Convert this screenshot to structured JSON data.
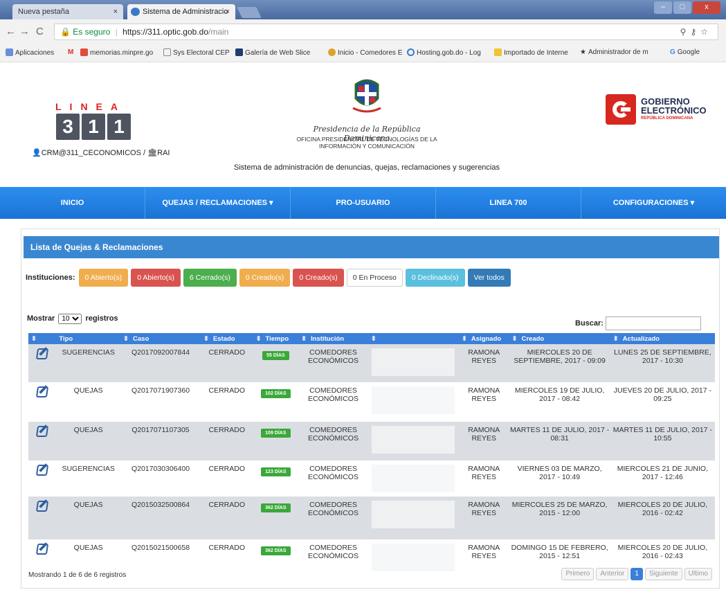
{
  "browser": {
    "tabs": [
      {
        "label": "Nueva pestaña"
      },
      {
        "label": "Sistema de Administracio"
      }
    ],
    "close_glyph": "×",
    "window_buttons": [
      "–",
      "□",
      "x"
    ],
    "secure_label": "Es seguro",
    "url_host": "https://311.optic.gob.do",
    "url_path": "/main",
    "bookmarks": [
      "Aplicaciones",
      "M",
      "memorias.minpre.go",
      "Sys Electoral CEP",
      "Galería de Web Slice",
      "Inicio - Comedores E",
      "Hosting.gob.do - Log",
      "Importado de Interne",
      "Administrador de m",
      "Google"
    ]
  },
  "header": {
    "linea_letters": "LINEA",
    "linea_digits": [
      "3",
      "1",
      "1"
    ],
    "user": "CRM@311_CECONOMICOS / ",
    "user_role": "RAI",
    "presidency": "Presidencia de la República Dominicana",
    "office": "OFICINA PRESIDENCIAL DE TECNOLOGÍAS DE LA INFORMACIÓN Y COMUNICACIÓN",
    "system_name": "Sistema de administración de denuncias, quejas, reclamaciones y sugerencias",
    "gob_line1": "GOBIERNO",
    "gob_line2": "ELECTRÓNICO",
    "gob_sub": "REPÚBLICA DOMINICANA"
  },
  "nav": {
    "items": [
      "INICIO",
      "QUEJAS / RECLAMACIONES ▾",
      "PRO-USUARIO",
      "LINEA 700",
      "CONFIGURACIONES ▾"
    ]
  },
  "panel": {
    "title": "Lista de Quejas & Reclamaciones",
    "instituciones_label": "Instituciones:",
    "filters": [
      {
        "label": "0 Abierto(s)",
        "color": "#f0ad4e"
      },
      {
        "label": "0 Abierto(s)",
        "color": "#d9534f"
      },
      {
        "label": "6 Cerrado(s)",
        "color": "#4cae4c"
      },
      {
        "label": "0 Creado(s)",
        "color": "#f0ad4e"
      },
      {
        "label": "0 Creado(s)",
        "color": "#d9534f"
      },
      {
        "label": "0 En Proceso",
        "color": "#ffffff"
      },
      {
        "label": "0 Declinado(s)",
        "color": "#5bc0de"
      },
      {
        "label": "Ver todos",
        "color": "#337ab7"
      }
    ],
    "show_label": "Mostrar",
    "show_value": "10",
    "records_label": "registros",
    "search_label": "Buscar:",
    "columns": [
      "",
      "Tipo",
      "Caso",
      "Estado",
      "Tiempo",
      "Institución",
      "",
      "Asignado",
      "Creado",
      "Actualizado"
    ],
    "rows": [
      {
        "tipo": "SUGERENCIAS",
        "caso": "Q2017092007844",
        "estado": "CERRADO",
        "tiempo": "55 DÍAS",
        "institucion": "COMEDORES ECONÓMICOS",
        "asignado": "RAMONA REYES",
        "creado": "MIERCOLES 20 DE SEPTIEMBRE, 2017 - 09:09",
        "actualizado": "LUNES 25 DE SEPTIEMBRE, 2017 - 10:30"
      },
      {
        "tipo": "QUEJAS",
        "caso": "Q2017071907360",
        "estado": "CERRADO",
        "tiempo": "102 DÍAS",
        "institucion": "COMEDORES ECONÓMICOS",
        "asignado": "RAMONA REYES",
        "creado": "MIERCOLES 19 DE JULIO, 2017 - 08:42",
        "actualizado": "JUEVES 20 DE JULIO, 2017 - 09:25"
      },
      {
        "tipo": "QUEJAS",
        "caso": "Q2017071107305",
        "estado": "CERRADO",
        "tiempo": "109 DÍAS",
        "institucion": "COMEDORES ECONÓMICOS",
        "asignado": "RAMONA REYES",
        "creado": "MARTES 11 DE JULIO, 2017 - 08:31",
        "actualizado": "MARTES 11 DE JULIO, 2017 - 10:55"
      },
      {
        "tipo": "SUGERENCIAS",
        "caso": "Q2017030306400",
        "estado": "CERRADO",
        "tiempo": "123 DÍAS",
        "institucion": "COMEDORES ECONÓMICOS",
        "asignado": "RAMONA REYES",
        "creado": "VIERNES 03 DE MARZO, 2017 - 10:49",
        "actualizado": "MIERCOLES 21 DE JUNIO, 2017 - 12:46"
      },
      {
        "tipo": "QUEJAS",
        "caso": "Q2015032500864",
        "estado": "CERRADO",
        "tiempo": "362 DÍAS",
        "institucion": "COMEDORES ECONÓMICOS",
        "asignado": "RAMONA REYES",
        "creado": "MIERCOLES 25 DE MARZO, 2015 - 12:00",
        "actualizado": "MIERCOLES 20 DE JULIO, 2016 - 02:42"
      },
      {
        "tipo": "QUEJAS",
        "caso": "Q2015021500658",
        "estado": "CERRADO",
        "tiempo": "362 DÍAS",
        "institucion": "COMEDORES ECONÓMICOS",
        "asignado": "RAMONA REYES",
        "creado": "DOMINGO 15 DE FEBRERO, 2015 - 12:51",
        "actualizado": "MIERCOLES 20 DE JULIO, 2016 - 02:43"
      }
    ],
    "info": "Mostrando 1 de 6 de 6 registros",
    "pager": [
      "Primero",
      "Anterior",
      "1",
      "Siguiente",
      "Ultimo"
    ]
  }
}
